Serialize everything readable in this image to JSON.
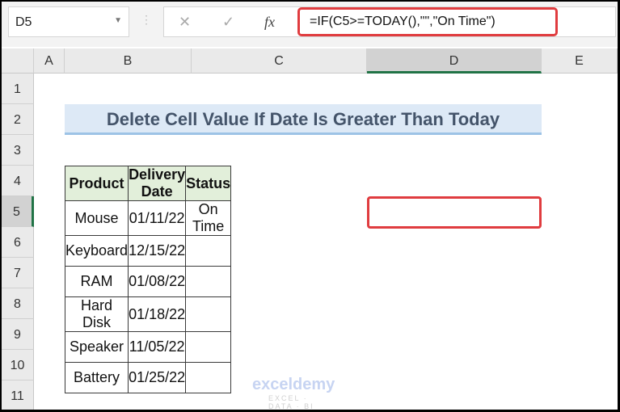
{
  "formula_bar": {
    "name_box": "D5",
    "cancel_icon": "✕",
    "enter_icon": "✓",
    "fx_icon": "fx",
    "formula": "=IF(C5>=TODAY(),\"\",\"On Time\")"
  },
  "columns": [
    "A",
    "B",
    "C",
    "D",
    "E"
  ],
  "rows": [
    "1",
    "2",
    "3",
    "4",
    "5",
    "6",
    "7",
    "8",
    "9",
    "10",
    "11"
  ],
  "selected_cell": "D5",
  "title": "Delete Cell Value If Date Is Greater Than Today",
  "table": {
    "headers": [
      "Product",
      "Delivery Date",
      "Status"
    ],
    "rows": [
      [
        "Mouse",
        "01/11/22",
        "On Time"
      ],
      [
        "Keyboard",
        "12/15/22",
        ""
      ],
      [
        "RAM",
        "01/08/22",
        ""
      ],
      [
        "Hard Disk",
        "01/18/22",
        ""
      ],
      [
        "Speaker",
        "11/05/22",
        ""
      ],
      [
        "Battery",
        "01/25/22",
        ""
      ]
    ]
  },
  "watermark": {
    "brand": "exceldemy",
    "tagline": "EXCEL · DATA · BI"
  },
  "colors": {
    "highlight": "#e03c3f",
    "header_fill": "#e2efda",
    "title_fill": "#dde9f6",
    "selection": "#217346"
  }
}
